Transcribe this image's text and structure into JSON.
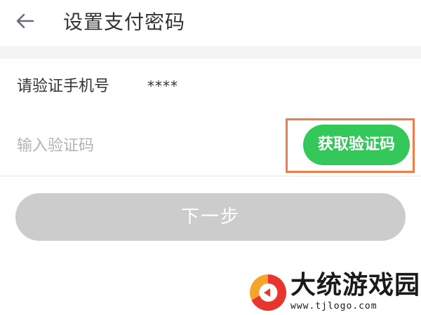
{
  "header": {
    "back_icon": "back-arrow-icon",
    "title": "设置支付密码"
  },
  "form": {
    "phone_label": "请验证手机号",
    "phone_value": "****",
    "code_input_value": "",
    "code_input_placeholder": "输入验证码",
    "get_code_label": "获取验证码"
  },
  "actions": {
    "next_label": "下一步"
  },
  "watermark": {
    "title": "大统游戏园",
    "url": "www.tjlogo.com"
  },
  "colors": {
    "accent_green": "#34c759",
    "highlight_orange": "#f07c4b",
    "disabled_gray": "#cccccc",
    "title_text": "#333333",
    "placeholder_text": "#b3b3b3",
    "band_gray": "#f4f4f4",
    "watermark_red": "#e8352e"
  }
}
